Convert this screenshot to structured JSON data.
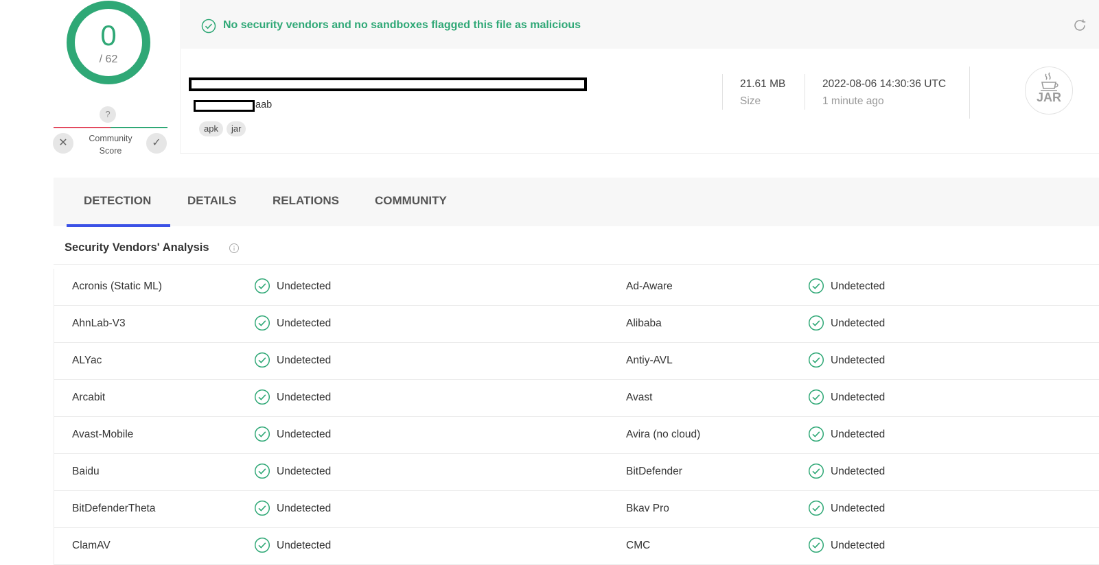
{
  "score": {
    "detections": "0",
    "total": "/ 62"
  },
  "community": {
    "question": "?",
    "label_line1": "Community",
    "label_line2": "Score",
    "x": "✕",
    "check": "✓"
  },
  "banner": {
    "text": "No security vendors and no sandboxes flagged this file as malicious"
  },
  "file": {
    "name_suffix": "aab",
    "tags": [
      "apk",
      "jar"
    ],
    "size_value": "21.61 MB",
    "size_label": "Size",
    "date_value": "2022-08-06 14:30:36 UTC",
    "date_label": "1 minute ago",
    "type_icon": "JAR"
  },
  "tabs": [
    {
      "label": "DETECTION",
      "active": true
    },
    {
      "label": "DETAILS",
      "active": false
    },
    {
      "label": "RELATIONS",
      "active": false
    },
    {
      "label": "COMMUNITY",
      "active": false
    }
  ],
  "section": {
    "title": "Security Vendors' Analysis"
  },
  "status_color": "#2fa876",
  "vendors": [
    {
      "left": "Acronis (Static ML)",
      "left_status": "Undetected",
      "right": "Ad-Aware",
      "right_status": "Undetected"
    },
    {
      "left": "AhnLab-V3",
      "left_status": "Undetected",
      "right": "Alibaba",
      "right_status": "Undetected"
    },
    {
      "left": "ALYac",
      "left_status": "Undetected",
      "right": "Antiy-AVL",
      "right_status": "Undetected"
    },
    {
      "left": "Arcabit",
      "left_status": "Undetected",
      "right": "Avast",
      "right_status": "Undetected"
    },
    {
      "left": "Avast-Mobile",
      "left_status": "Undetected",
      "right": "Avira (no cloud)",
      "right_status": "Undetected"
    },
    {
      "left": "Baidu",
      "left_status": "Undetected",
      "right": "BitDefender",
      "right_status": "Undetected"
    },
    {
      "left": "BitDefenderTheta",
      "left_status": "Undetected",
      "right": "Bkav Pro",
      "right_status": "Undetected"
    },
    {
      "left": "ClamAV",
      "left_status": "Undetected",
      "right": "CMC",
      "right_status": "Undetected"
    }
  ]
}
